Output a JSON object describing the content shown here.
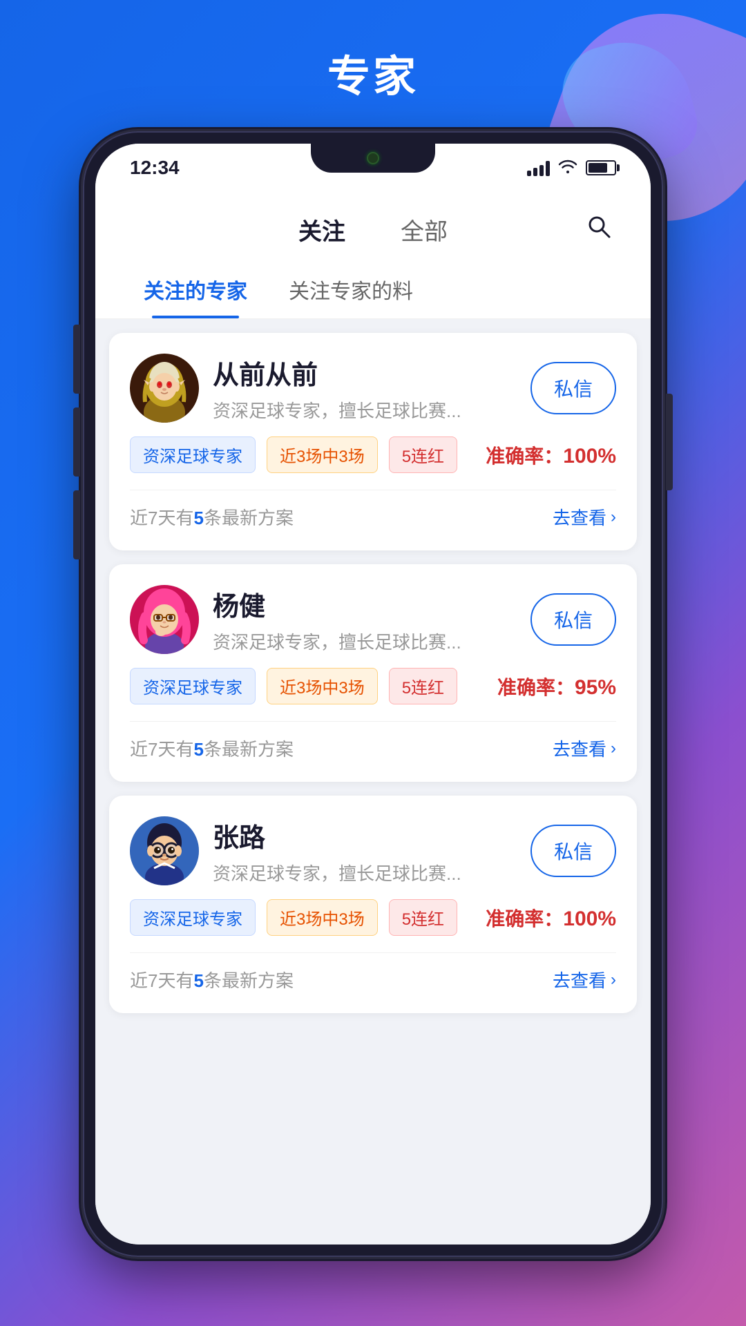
{
  "page": {
    "title": "专家",
    "background_gradient": "#1565e8"
  },
  "status_bar": {
    "time": "12:34",
    "signal_label": "signal",
    "wifi_label": "wifi",
    "battery_label": "battery"
  },
  "main_nav": {
    "tabs": [
      {
        "id": "follow",
        "label": "关注",
        "active": true
      },
      {
        "id": "all",
        "label": "全部",
        "active": false
      }
    ],
    "search_label": "搜索"
  },
  "sub_tabs": [
    {
      "id": "followed_experts",
      "label": "关注的专家",
      "active": true
    },
    {
      "id": "experts_tips",
      "label": "关注专家的料",
      "active": false
    }
  ],
  "experts": [
    {
      "id": 1,
      "name": "从前从前",
      "description": "资深足球专家，擅长足球比赛...",
      "private_msg_label": "私信",
      "tags": [
        "资深足球专家",
        "近3场中3场",
        "5连红"
      ],
      "accuracy_label": "准确率：",
      "accuracy_value": "100%",
      "recent_label_prefix": "近7天有",
      "recent_count": "5",
      "recent_label_suffix": "条最新方案",
      "view_label": "去查看"
    },
    {
      "id": 2,
      "name": "杨健",
      "description": "资深足球专家，擅长足球比赛...",
      "private_msg_label": "私信",
      "tags": [
        "资深足球专家",
        "近3场中3场",
        "5连红"
      ],
      "accuracy_label": "准确率：",
      "accuracy_value": "95%",
      "recent_label_prefix": "近7天有",
      "recent_count": "5",
      "recent_label_suffix": "条最新方案",
      "view_label": "去查看"
    },
    {
      "id": 3,
      "name": "张路",
      "description": "资深足球专家，擅长足球比赛...",
      "private_msg_label": "私信",
      "tags": [
        "资深足球专家",
        "近3场中3场",
        "5连红"
      ],
      "accuracy_label": "准确率：",
      "accuracy_value": "100%",
      "recent_label_prefix": "近7天有",
      "recent_count": "5",
      "recent_label_suffix": "条最新方案",
      "view_label": "去查看"
    }
  ]
}
